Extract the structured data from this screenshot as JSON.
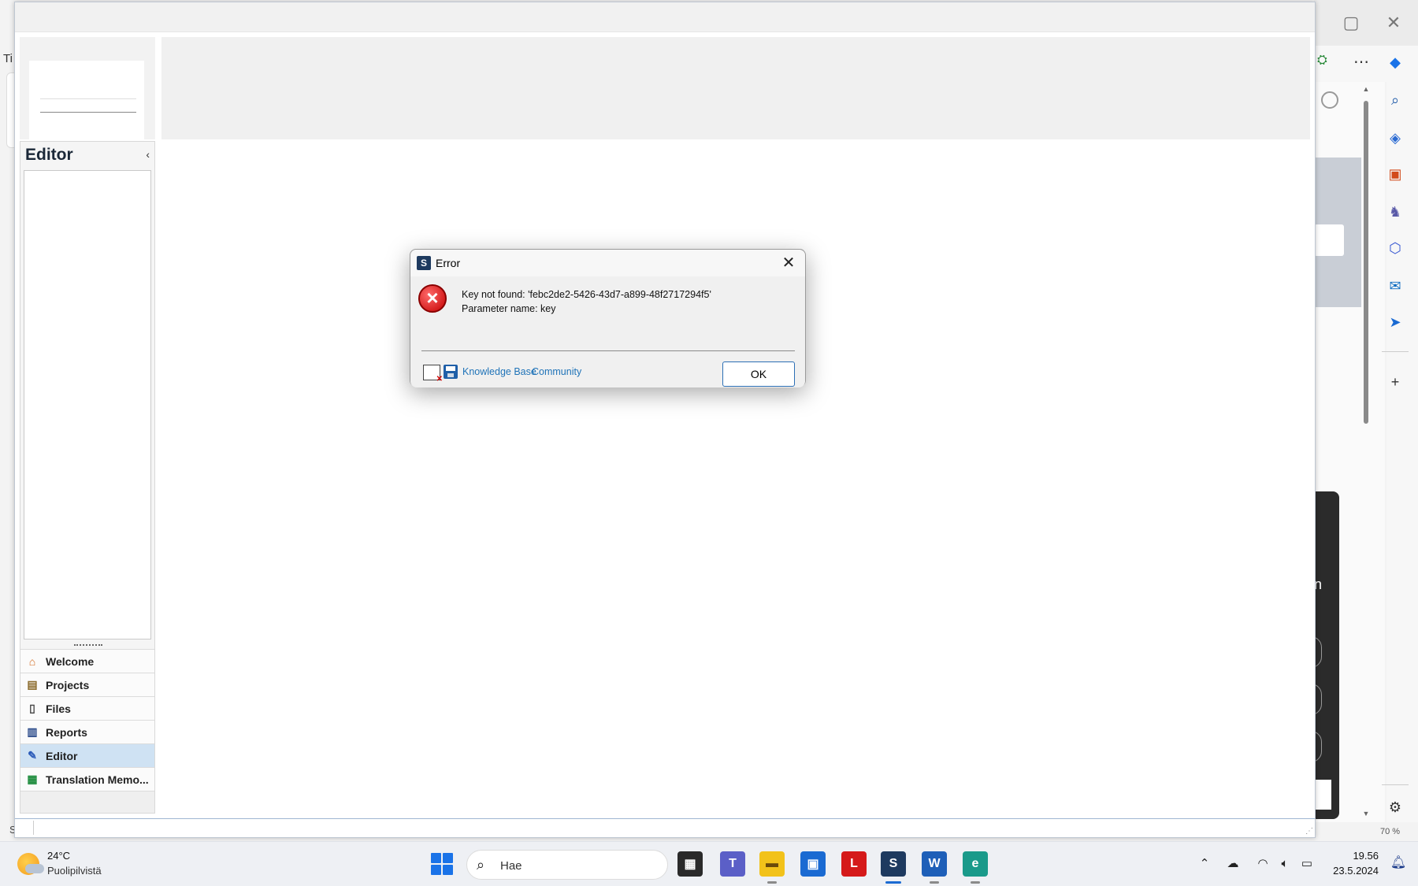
{
  "background_window": {
    "left_partial_text": "Ti",
    "left_partial_status": "S",
    "dark_panel_partial_text": "n",
    "status_zoom": "70 %"
  },
  "app": {
    "nav_title": "Editor",
    "nav_collapse_glyph": "‹",
    "nav_items": [
      {
        "label": "Welcome",
        "icon": "home-icon"
      },
      {
        "label": "Projects",
        "icon": "projects-icon"
      },
      {
        "label": "Files",
        "icon": "files-icon"
      },
      {
        "label": "Reports",
        "icon": "reports-icon"
      },
      {
        "label": "Editor",
        "icon": "editor-pencil-icon",
        "active": true
      },
      {
        "label": "Translation Memo...",
        "icon": "translation-memories-icon"
      }
    ]
  },
  "dialog": {
    "title": "Error",
    "message_line1": "Key not found: 'febc2de2-5426-43d7-a899-48f2717294f5'",
    "message_line2": "Parameter name: key",
    "link_knowledge_base": "Knowledge Base",
    "link_community": "Community",
    "ok_label": "OK"
  },
  "taskbar": {
    "weather_temp": "24°C",
    "weather_desc": "Puolipilvistä",
    "search_placeholder": "Hae",
    "clock_time": "19.56",
    "clock_date": "23.5.2024",
    "apps": [
      "file-explorer-window",
      "teams",
      "file-explorer",
      "microsoft-store",
      "L-app",
      "trados-studio",
      "word",
      "edge"
    ]
  },
  "colors": {
    "accent_link": "#1f73b8",
    "active_nav": "#cfe2f3",
    "ok_border": "#2c6fb5",
    "error_red": "#c40000"
  }
}
